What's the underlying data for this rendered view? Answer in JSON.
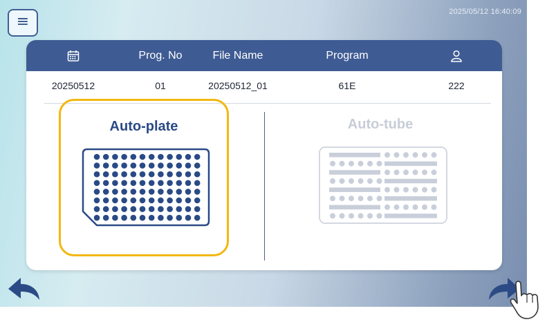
{
  "header": {
    "menu_icon": "hamburger-menu-icon",
    "datetime": "2025/05/12 16:40:09"
  },
  "table": {
    "columns": [
      {
        "icon": "calendar-icon"
      },
      {
        "label": "Prog. No"
      },
      {
        "label": "File Name"
      },
      {
        "label": "Program"
      },
      {
        "icon": "user-icon"
      }
    ],
    "row": {
      "date": "20250512",
      "prog_no": "01",
      "file_name": "20250512_01",
      "program": "61E",
      "user": "222"
    }
  },
  "options": [
    {
      "label": "Auto-plate",
      "icon": "96-well-plate-icon",
      "selected": true,
      "color": "#2a4a86"
    },
    {
      "label": "Auto-tube",
      "icon": "tube-strip-rack-icon",
      "selected": false,
      "color": "#c7cdd8"
    }
  ],
  "nav": {
    "back_icon": "back-arrow-icon",
    "forward_icon": "forward-arrow-icon",
    "pointer_icon": "hand-pointer-icon"
  },
  "colors": {
    "header_bg": "#3e5b93",
    "selection_border": "#f3b710",
    "accent": "#2a4a86"
  }
}
